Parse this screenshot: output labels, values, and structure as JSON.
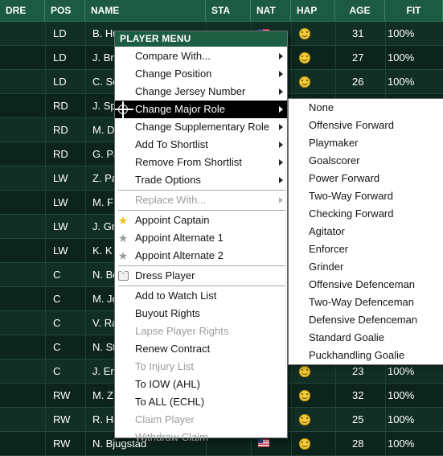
{
  "columns": [
    "DRE",
    "POS",
    "NAME",
    "STA",
    "NAT",
    "HAP",
    "AGE",
    "FIT"
  ],
  "rows": [
    {
      "pos": "LD",
      "name": "B. Hu",
      "flag": "us",
      "hap": true,
      "age": "31",
      "fit": "100%"
    },
    {
      "pos": "LD",
      "name": "J. Bro",
      "flag": "",
      "hap": true,
      "age": "27",
      "fit": "100%"
    },
    {
      "pos": "LD",
      "name": "C. Sc",
      "flag": "",
      "hap": true,
      "age": "26",
      "fit": "100%"
    },
    {
      "pos": "RD",
      "name": "J. Sp",
      "flag": "",
      "hap": false,
      "age": "",
      "fit": ""
    },
    {
      "pos": "RD",
      "name": "M. D",
      "flag": "",
      "hap": false,
      "age": "",
      "fit": ""
    },
    {
      "pos": "RD",
      "name": "G. Pa",
      "flag": "",
      "hap": false,
      "age": "",
      "fit": ""
    },
    {
      "pos": "LW",
      "name": "Z. Pa",
      "flag": "",
      "hap": false,
      "age": "",
      "fit": ""
    },
    {
      "pos": "LW",
      "name": "M. F",
      "flag": "",
      "hap": false,
      "age": "",
      "fit": ""
    },
    {
      "pos": "LW",
      "name": "J. Gr",
      "flag": "",
      "hap": false,
      "age": "",
      "fit": ""
    },
    {
      "pos": "LW",
      "name": "K. K",
      "flag": "",
      "hap": false,
      "age": "",
      "fit": ""
    },
    {
      "pos": "C",
      "name": "N. Bo",
      "flag": "",
      "hap": false,
      "age": "",
      "fit": ""
    },
    {
      "pos": "C",
      "name": "M. Jo",
      "flag": "",
      "hap": false,
      "age": "",
      "fit": ""
    },
    {
      "pos": "C",
      "name": "V. Ra",
      "flag": "",
      "hap": false,
      "age": "",
      "fit": ""
    },
    {
      "pos": "C",
      "name": "N. St",
      "flag": "",
      "hap": false,
      "age": "",
      "fit": ""
    },
    {
      "pos": "C",
      "name": "J. Eri",
      "flag": "",
      "hap": true,
      "age": "23",
      "fit": "100%"
    },
    {
      "pos": "RW",
      "name": "M. Z",
      "flag": "",
      "hap": true,
      "age": "32",
      "fit": "100%"
    },
    {
      "pos": "RW",
      "name": "R. Ha",
      "flag": "",
      "hap": true,
      "age": "25",
      "fit": "100%"
    },
    {
      "pos": "RW",
      "name": "N. Bjugstad",
      "flag": "us",
      "hap": true,
      "age": "28",
      "fit": "100%"
    }
  ],
  "menu": {
    "title": "PLAYER MENU",
    "items": [
      {
        "label": "Compare With...",
        "submenu": true,
        "disabled": false,
        "icon": ""
      },
      {
        "label": "Change Position",
        "submenu": true,
        "disabled": false,
        "icon": ""
      },
      {
        "label": "Change Jersey Number",
        "submenu": true,
        "disabled": false,
        "icon": ""
      },
      {
        "label": "Change Major Role",
        "submenu": true,
        "disabled": false,
        "icon": "target-icon",
        "selected": true
      },
      {
        "label": "Change Supplementary Role",
        "submenu": true,
        "disabled": false,
        "icon": ""
      },
      {
        "label": "Add To Shortlist",
        "submenu": true,
        "disabled": false,
        "icon": ""
      },
      {
        "label": "Remove From Shortlist",
        "submenu": true,
        "disabled": false,
        "icon": ""
      },
      {
        "label": "Trade Options",
        "submenu": true,
        "disabled": false,
        "icon": ""
      },
      {
        "separator": true
      },
      {
        "label": "Replace With...",
        "submenu": true,
        "disabled": true,
        "icon": ""
      },
      {
        "separator": true
      },
      {
        "label": "Appoint Captain",
        "submenu": false,
        "disabled": false,
        "icon": "gold-star-icon"
      },
      {
        "label": "Appoint Alternate 1",
        "submenu": false,
        "disabled": false,
        "icon": "gray-star-icon"
      },
      {
        "label": "Appoint Alternate 2",
        "submenu": false,
        "disabled": false,
        "icon": "gray-star-icon"
      },
      {
        "separator": true
      },
      {
        "label": "Dress Player",
        "submenu": false,
        "disabled": false,
        "icon": "jersey-icon"
      },
      {
        "separator": true
      },
      {
        "label": "Add to Watch List",
        "submenu": false,
        "disabled": false,
        "icon": ""
      },
      {
        "label": "Buyout Rights",
        "submenu": false,
        "disabled": false,
        "icon": ""
      },
      {
        "label": "Lapse Player Rights",
        "submenu": false,
        "disabled": true,
        "icon": ""
      },
      {
        "label": "Renew Contract",
        "submenu": false,
        "disabled": false,
        "icon": ""
      },
      {
        "label": "To Injury List",
        "submenu": false,
        "disabled": true,
        "icon": ""
      },
      {
        "label": "To IOW (AHL)",
        "submenu": false,
        "disabled": false,
        "icon": ""
      },
      {
        "label": "To ALL (ECHL)",
        "submenu": false,
        "disabled": false,
        "icon": ""
      },
      {
        "label": "Claim Player",
        "submenu": false,
        "disabled": true,
        "icon": ""
      },
      {
        "label": "Withdraw Claim",
        "submenu": false,
        "disabled": true,
        "icon": ""
      }
    ]
  },
  "submenu": {
    "items": [
      "None",
      "Offensive Forward",
      "Playmaker",
      "Goalscorer",
      "Power Forward",
      "Two-Way Forward",
      "Checking Forward",
      "Agitator",
      "Enforcer",
      "Grinder",
      "Offensive Defenceman",
      "Two-Way Defenceman",
      "Defensive Defenceman",
      "Standard Goalie",
      "Puckhandling Goalie"
    ]
  },
  "colors": {
    "header": "#1c5a41",
    "background": "#0f2a21",
    "menu_title": "#1d5d42",
    "selected": "#000000"
  }
}
